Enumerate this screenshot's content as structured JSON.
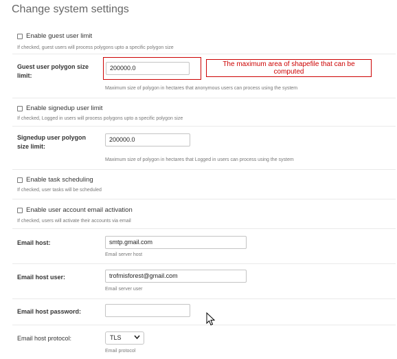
{
  "page": {
    "title": "Change system settings"
  },
  "guest_limit": {
    "checkbox_label": "Enable guest user limit",
    "checked": false,
    "help": "If checked, guest users will process polygons upto a specific polygon size"
  },
  "guest_size": {
    "label_line1": "Guest user polygon size",
    "label_line2": "limit:",
    "value": "200000.0",
    "help": "Maximum size of polygon in hectares that anonymous users can process using the system"
  },
  "annotation": {
    "text": "The maximum area of shapefile that can be computed",
    "color": "#cc0000"
  },
  "signup_limit": {
    "checkbox_label": "Enable signedup user limit",
    "checked": false,
    "help": "If checked, Logged in users will process polygons upto a specific polygon size"
  },
  "signup_size": {
    "label_line1": "Signedup user polygon",
    "label_line2": "size limit:",
    "value": "200000.0",
    "help": "Maximum size of polygon in hectares that Logged in users can process using the system"
  },
  "task_scheduling": {
    "checkbox_label": "Enable task scheduling",
    "checked": false,
    "help": "If checked, user tasks will be scheduled"
  },
  "email_activation": {
    "checkbox_label": "Enable user account email activation",
    "checked": false,
    "help": "If checked, users will activate their accounts via email"
  },
  "email_host": {
    "label": "Email host:",
    "value": "smtp.gmail.com",
    "help": "Email server host"
  },
  "email_host_user": {
    "label": "Email host user:",
    "value": "trofmisforest@gmail.com",
    "help": "Email server user"
  },
  "email_host_password": {
    "label": "Email host password:",
    "value": ""
  },
  "email_protocol": {
    "label": "Email host protocol:",
    "selected": "TLS",
    "help": "Email protocol"
  },
  "icons": {
    "cursor": "mouse-pointer-icon",
    "dropdown": "chevron-down-icon"
  }
}
